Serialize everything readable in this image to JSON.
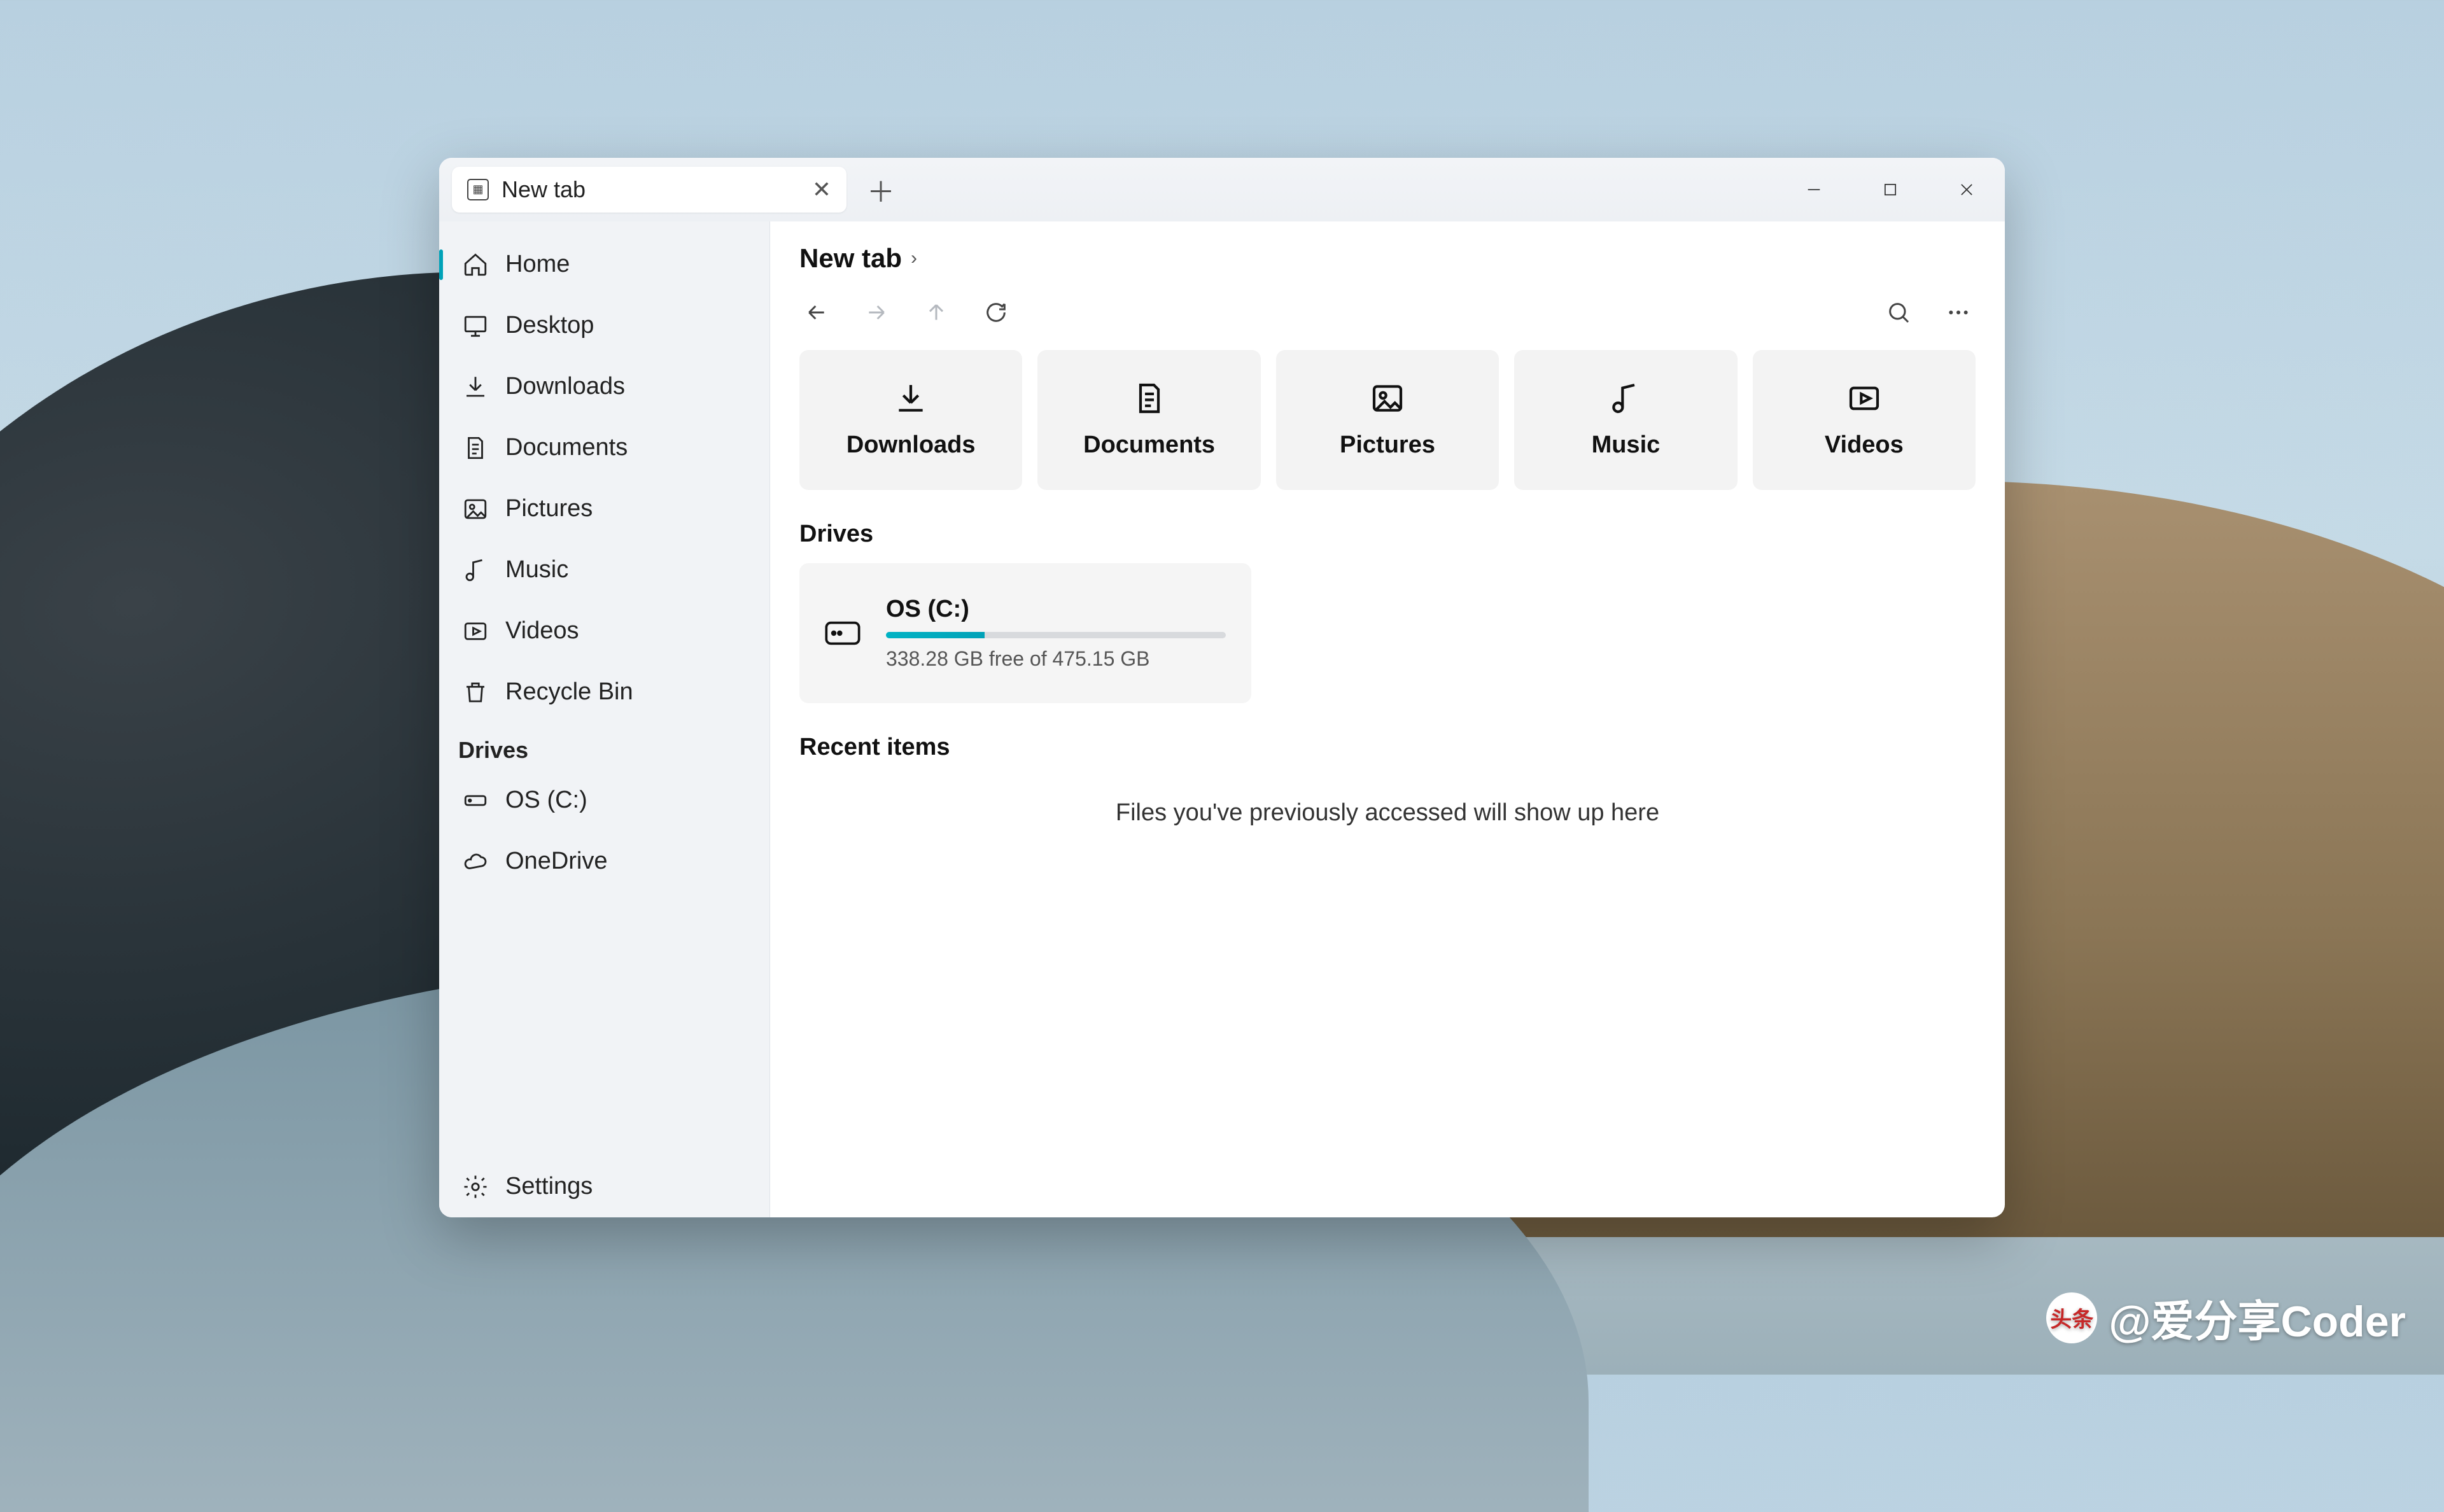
{
  "tab": {
    "label": "New  tab"
  },
  "sidebar": {
    "items": [
      {
        "label": "Home"
      },
      {
        "label": "Desktop"
      },
      {
        "label": "Downloads"
      },
      {
        "label": "Documents"
      },
      {
        "label": "Pictures"
      },
      {
        "label": "Music"
      },
      {
        "label": "Videos"
      },
      {
        "label": "Recycle Bin"
      }
    ],
    "drives_heading": "Drives",
    "drives": [
      {
        "label": "OS (C:)"
      },
      {
        "label": "OneDrive"
      }
    ],
    "settings_label": "Settings"
  },
  "breadcrumb": {
    "title": "New tab"
  },
  "quick": [
    {
      "label": "Downloads"
    },
    {
      "label": "Documents"
    },
    {
      "label": "Pictures"
    },
    {
      "label": "Music"
    },
    {
      "label": "Videos"
    }
  ],
  "sections": {
    "drives": "Drives",
    "recent": "Recent items"
  },
  "drive": {
    "name": "OS (C:)",
    "free_text": "338.28 GB free of 475.15 GB",
    "used_pct": 29
  },
  "recent_empty": "Files you've previously accessed will show up here",
  "watermark": "@爱分享Coder",
  "watermark_logo": "头条"
}
